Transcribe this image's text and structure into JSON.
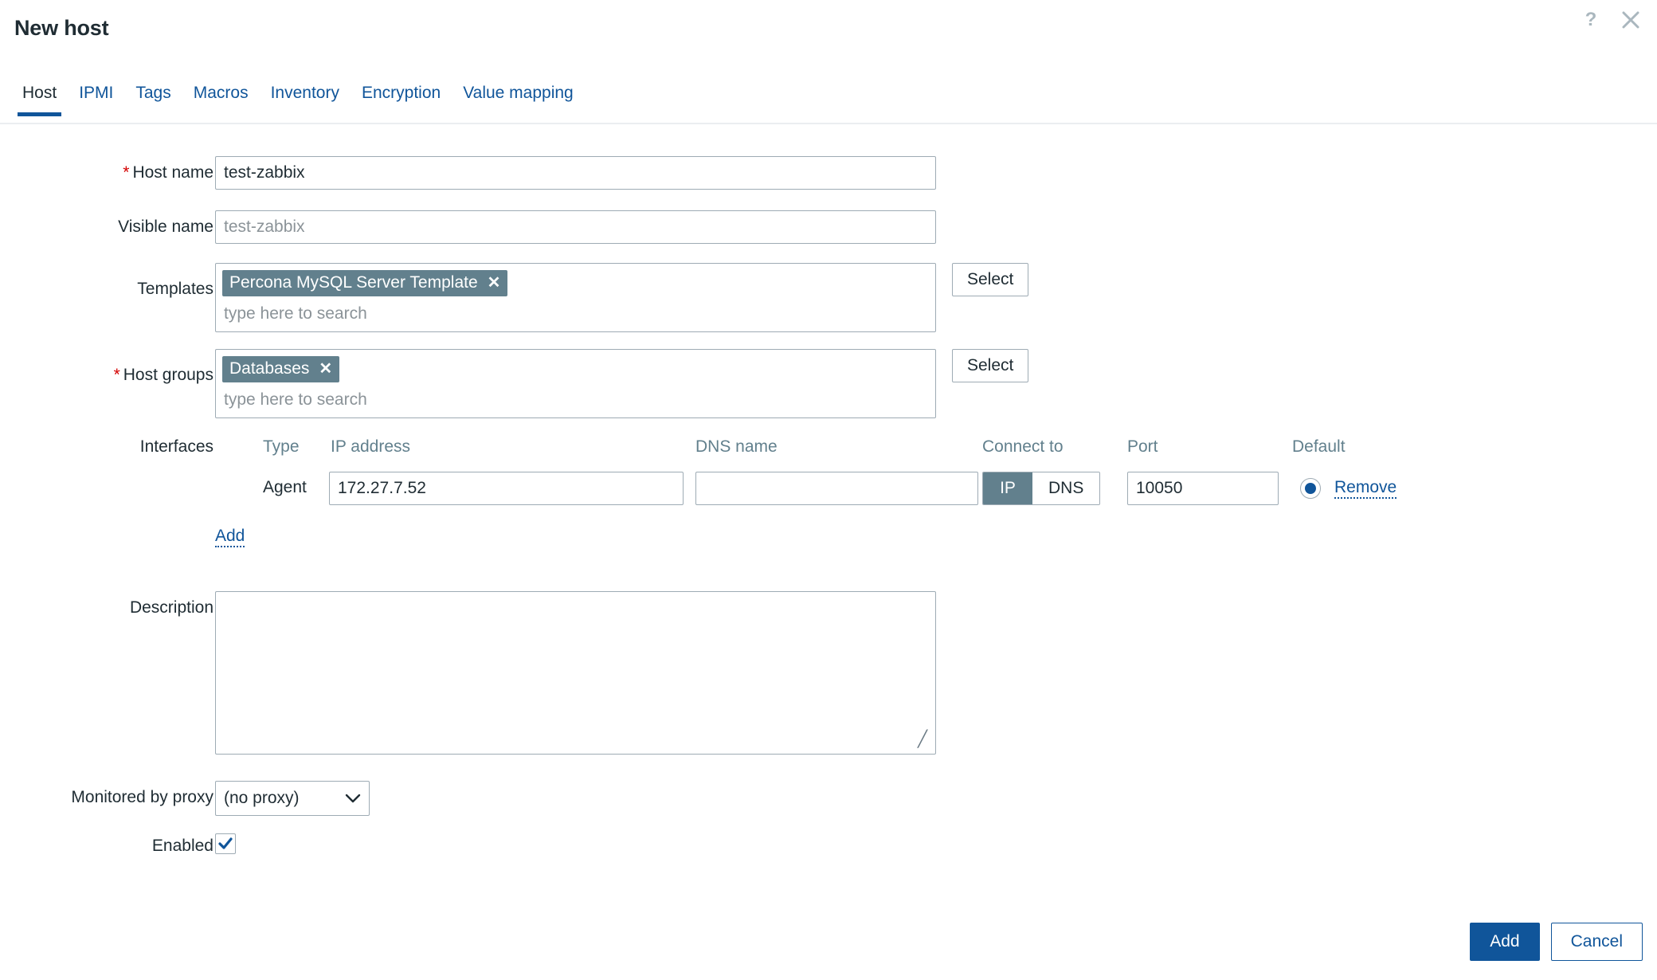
{
  "dialog": {
    "title": "New host",
    "help_icon": "question-mark-icon",
    "close_icon": "close-icon"
  },
  "tabs": [
    {
      "label": "Host",
      "active": true
    },
    {
      "label": "IPMI",
      "active": false
    },
    {
      "label": "Tags",
      "active": false
    },
    {
      "label": "Macros",
      "active": false
    },
    {
      "label": "Inventory",
      "active": false
    },
    {
      "label": "Encryption",
      "active": false
    },
    {
      "label": "Value mapping",
      "active": false
    }
  ],
  "form": {
    "host_name": {
      "label": "Host name",
      "required_marker": "*",
      "value": "test-zabbix"
    },
    "visible_name": {
      "label": "Visible name",
      "value": "",
      "placeholder": "test-zabbix"
    },
    "templates": {
      "label": "Templates",
      "chips": [
        "Percona MySQL Server Template"
      ],
      "chip_remove_glyph": "✕",
      "search_placeholder": "type here to search",
      "select_label": "Select"
    },
    "host_groups": {
      "label": "Host groups",
      "required_marker": "*",
      "chips": [
        "Databases"
      ],
      "chip_remove_glyph": "✕",
      "search_placeholder": "type here to search",
      "select_label": "Select"
    },
    "interfaces": {
      "label": "Interfaces",
      "columns": {
        "type": "Type",
        "ip_address": "IP address",
        "dns_name": "DNS name",
        "connect_to": "Connect to",
        "port": "Port",
        "default": "Default"
      },
      "rows": [
        {
          "type": "Agent",
          "ip_address": "172.27.7.52",
          "dns_name": "",
          "connect_to_options": [
            "IP",
            "DNS"
          ],
          "connect_to_selected": "IP",
          "port": "10050",
          "is_default": true,
          "remove_label": "Remove"
        }
      ],
      "add_label": "Add"
    },
    "description": {
      "label": "Description",
      "value": ""
    },
    "monitored_by_proxy": {
      "label": "Monitored by proxy",
      "selected": "(no proxy)"
    },
    "enabled": {
      "label": "Enabled",
      "checked": true
    }
  },
  "footer": {
    "add_label": "Add",
    "cancel_label": "Cancel"
  },
  "colors": {
    "accent_blue": "#10559a",
    "chip_slate": "#62808d",
    "required_red": "#d40000",
    "border_grey": "#9eabb4",
    "muted_label": "#62808d"
  }
}
